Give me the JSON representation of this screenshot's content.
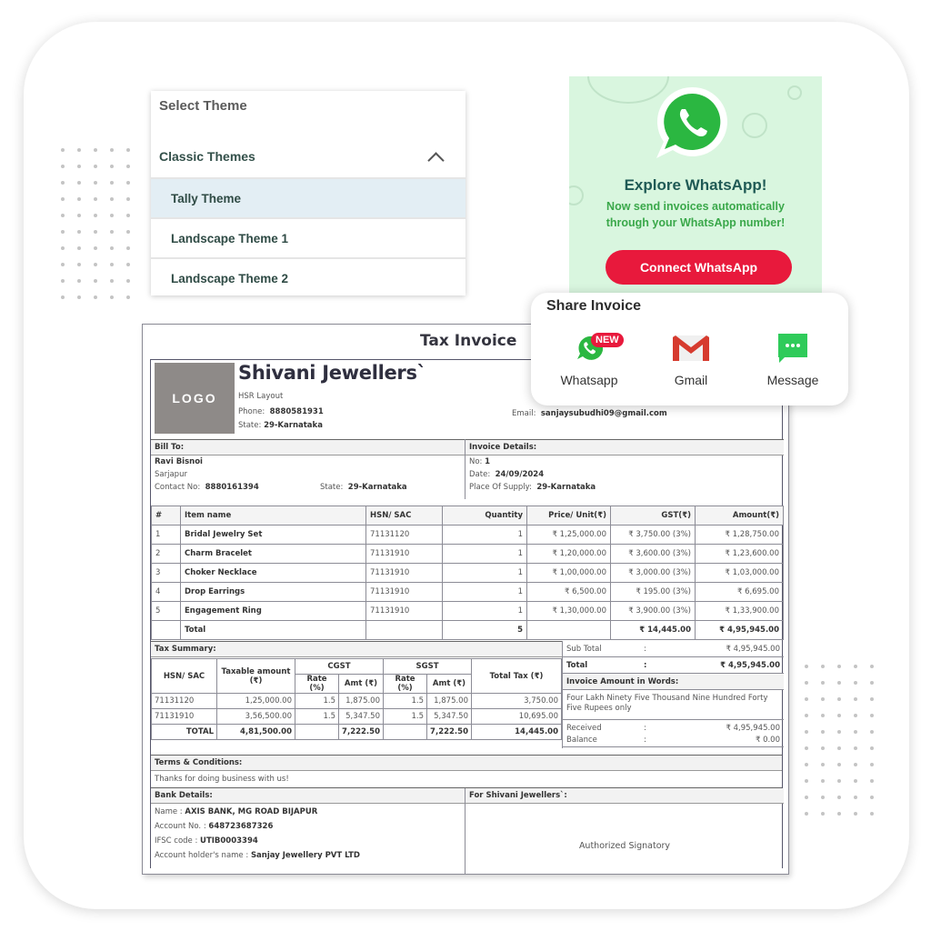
{
  "theme_selector": {
    "title": "Select Theme",
    "group_label": "Classic Themes",
    "options": [
      {
        "label": "Tally Theme",
        "selected": true
      },
      {
        "label": "Landscape Theme 1",
        "selected": false
      },
      {
        "label": "Landscape Theme 2",
        "selected": false
      }
    ]
  },
  "whatsapp_promo": {
    "title": "Explore WhatsApp!",
    "subtitle_line1": "Now send invoices automatically",
    "subtitle_line2": "through your WhatsApp number!",
    "button_label": "Connect WhatsApp",
    "colors": {
      "background": "#d9f6df",
      "button": "#e8193c",
      "title": "#1f5a55",
      "subtitle": "#3aa84a"
    }
  },
  "share_invoice": {
    "title": "Share Invoice",
    "options": [
      {
        "label": "Whatsapp",
        "icon": "whatsapp-icon",
        "badge": "NEW"
      },
      {
        "label": "Gmail",
        "icon": "gmail-icon"
      },
      {
        "label": "Message",
        "icon": "message-icon"
      }
    ]
  },
  "invoice": {
    "title": "Tax Invoice",
    "logo_text": "LOGO",
    "business": {
      "name": "Shivani Jewellers`",
      "address": "HSR Layout",
      "phone_label": "Phone:",
      "phone": "8880581931",
      "state_label": "State:",
      "state": "29-Karnataka",
      "email_label": "Email:",
      "email": "sanjaysubudhi09@gmail.com"
    },
    "bill_to": {
      "header": "Bill To:",
      "name": "Ravi Bisnoi",
      "address": "Sarjapur",
      "contact_label": "Contact No:",
      "contact": "8880161394",
      "state_label": "State:",
      "state": "29-Karnataka"
    },
    "details": {
      "header": "Invoice Details:",
      "no_label": "No:",
      "no": "1",
      "date_label": "Date:",
      "date": "24/09/2024",
      "pos_label": "Place Of Supply:",
      "pos": "29-Karnataka"
    },
    "items_columns": [
      "#",
      "Item name",
      "HSN/ SAC",
      "Quantity",
      "Price/ Unit(₹)",
      "GST(₹)",
      "Amount(₹)"
    ],
    "items": [
      {
        "n": "1",
        "name": "Bridal Jewelry Set",
        "hsn": "71131120",
        "qty": "1",
        "price": "₹ 1,25,000.00",
        "gst": "₹ 3,750.00 (3%)",
        "amount": "₹ 1,28,750.00"
      },
      {
        "n": "2",
        "name": "Charm Bracelet",
        "hsn": "71131910",
        "qty": "1",
        "price": "₹ 1,20,000.00",
        "gst": "₹ 3,600.00 (3%)",
        "amount": "₹ 1,23,600.00"
      },
      {
        "n": "3",
        "name": "Choker Necklace",
        "hsn": "71131910",
        "qty": "1",
        "price": "₹ 1,00,000.00",
        "gst": "₹ 3,000.00 (3%)",
        "amount": "₹ 1,03,000.00"
      },
      {
        "n": "4",
        "name": "Drop Earrings",
        "hsn": "71131910",
        "qty": "1",
        "price": "₹ 6,500.00",
        "gst": "₹ 195.00 (3%)",
        "amount": "₹ 6,695.00"
      },
      {
        "n": "5",
        "name": "Engagement Ring",
        "hsn": "71131910",
        "qty": "1",
        "price": "₹ 1,30,000.00",
        "gst": "₹ 3,900.00 (3%)",
        "amount": "₹ 1,33,900.00"
      }
    ],
    "items_total": {
      "label": "Total",
      "qty": "5",
      "gst": "₹ 14,445.00",
      "amount": "₹ 4,95,945.00"
    },
    "tax_summary": {
      "header": "Tax Summary:",
      "col_hsn": "HSN/ SAC",
      "col_taxable": "Taxable amount (₹)",
      "col_cgst": "CGST",
      "col_sgst": "SGST",
      "col_rate": "Rate (%)",
      "col_amt": "Amt (₹)",
      "col_total_tax": "Total Tax (₹)",
      "rows": [
        {
          "hsn": "71131120",
          "taxable": "1,25,000.00",
          "cgst_rate": "1.5",
          "cgst_amt": "1,875.00",
          "sgst_rate": "1.5",
          "sgst_amt": "1,875.00",
          "total": "3,750.00"
        },
        {
          "hsn": "71131910",
          "taxable": "3,56,500.00",
          "cgst_rate": "1.5",
          "cgst_amt": "5,347.50",
          "sgst_rate": "1.5",
          "sgst_amt": "5,347.50",
          "total": "10,695.00"
        }
      ],
      "total_row": {
        "label": "TOTAL",
        "taxable": "4,81,500.00",
        "cgst_amt": "7,222.50",
        "sgst_amt": "7,222.50",
        "total": "14,445.00"
      }
    },
    "totals": {
      "subtotal_label": "Sub Total",
      "subtotal": "₹ 4,95,945.00",
      "total_label": "Total",
      "total": "₹ 4,95,945.00",
      "words_header": "Invoice Amount in Words:",
      "words": "Four Lakh Ninety Five Thousand Nine Hundred Forty Five Rupees only",
      "received_label": "Received",
      "received": "₹ 4,95,945.00",
      "balance_label": "Balance",
      "balance": "₹ 0.00",
      "colon": ":"
    },
    "terms": {
      "header": "Terms & Conditions:",
      "text": "Thanks for doing business with us!"
    },
    "bank": {
      "header": "Bank Details:",
      "name_label": "Name :",
      "name": "AXIS BANK, MG ROAD BIJAPUR",
      "account_label": "Account No. :",
      "account": "648723687326",
      "ifsc_label": "IFSC code :",
      "ifsc": "UTIB0003394",
      "holder_label": "Account holder's name :",
      "holder": "Sanjay Jewellery PVT LTD"
    },
    "signatory": {
      "header": "For Shivani Jewellers`:",
      "text": "Authorized Signatory"
    }
  }
}
